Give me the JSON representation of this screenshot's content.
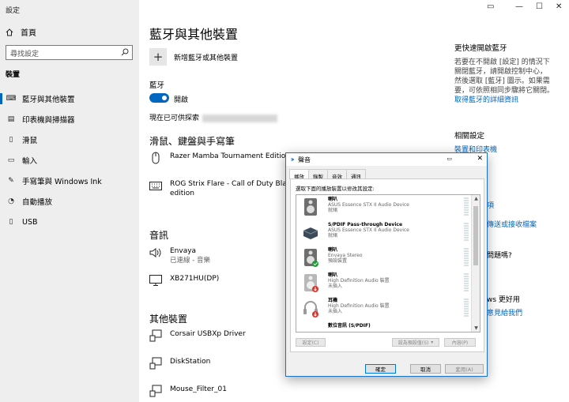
{
  "window": {
    "title": "設定"
  },
  "nav": {
    "home": "首頁",
    "search_placeholder": "尋找設定",
    "section": "裝置",
    "items": [
      {
        "label": "藍牙與其他裝置",
        "icon": "bluetooth-devices-icon"
      },
      {
        "label": "印表機與掃描器",
        "icon": "printer-icon"
      },
      {
        "label": "滑鼠",
        "icon": "mouse-icon"
      },
      {
        "label": "輸入",
        "icon": "keyboard-icon"
      },
      {
        "label": "手寫筆與 Windows Ink",
        "icon": "pen-icon"
      },
      {
        "label": "自動播放",
        "icon": "autoplay-icon"
      },
      {
        "label": "USB",
        "icon": "usb-icon"
      }
    ]
  },
  "main": {
    "title": "藍牙與其他裝置",
    "add_device": "新增藍牙或其他裝置",
    "bt_label": "藍牙",
    "bt_state": "開啟",
    "discoverable": "現在已可供探索",
    "mouse_section": "滑鼠、鍵盤與手寫筆",
    "mouse_devices": [
      {
        "name": "Razer Mamba Tournament Edition",
        "sub": ""
      },
      {
        "name": "ROG Strix Flare - Call of Duty Black",
        "name2": "edition",
        "sub": ""
      }
    ],
    "audio_section": "音訊",
    "audio_devices": [
      {
        "name": "Envaya",
        "sub": "已連線 - 音樂"
      },
      {
        "name": "XB271HU(DP)",
        "sub": ""
      }
    ],
    "other_section": "其他裝置",
    "other_devices": [
      {
        "name": "Corsair USBXp Driver"
      },
      {
        "name": "DiskStation"
      },
      {
        "name": "Mouse_Filter_01"
      }
    ]
  },
  "right": {
    "faster_hd": "更快速開啟藍牙",
    "faster_desc": [
      "若要在不開啟 [設定] 的情況下",
      "關閉藍牙，請開啟控制中心，",
      "然後選取 [藍牙] 圖示。如果需",
      "要，可依照相同步驟將它關閉。"
    ],
    "more_link": "取得藍牙的詳細資訊",
    "related_hd": "相關設定",
    "related_link1": "裝置和印表機",
    "frag1": "項",
    "frag2": "傳送或接收檔案",
    "frag3": "問題嗎?",
    "frag4": "ws 更好用",
    "frag5": "意見給我們"
  },
  "dialog": {
    "title": "聲音",
    "tabs": [
      "播放",
      "錄製",
      "音效",
      "通訊"
    ],
    "instruction": "選取下面的播放裝置以修改其設定:",
    "devices": [
      {
        "name": "喇叭",
        "desc": "ASUS Essence STX II Audio Device",
        "status": "就緒"
      },
      {
        "name": "S/PDIF Pass-through Device",
        "desc": "ASUS Essence STX II Audio Device",
        "status": "就緒"
      },
      {
        "name": "喇叭",
        "desc": "Envaya Stereo",
        "status": "預設裝置"
      },
      {
        "name": "喇叭",
        "desc": "High Definition Audio 裝置",
        "status": "未插入"
      },
      {
        "name": "耳機",
        "desc": "High Definition Audio 裝置",
        "status": "未插入"
      },
      {
        "name": "數位音訊 (S/PDIF)",
        "desc": "",
        "status": ""
      }
    ],
    "configure": "設定(C)",
    "set_default": "設為預設值(S)",
    "properties": "內容(P)",
    "ok": "確定",
    "cancel": "取消",
    "apply": "套用(A)"
  },
  "colors": {
    "accent": "#0067c0",
    "dialog_border": "#1c71c9"
  }
}
